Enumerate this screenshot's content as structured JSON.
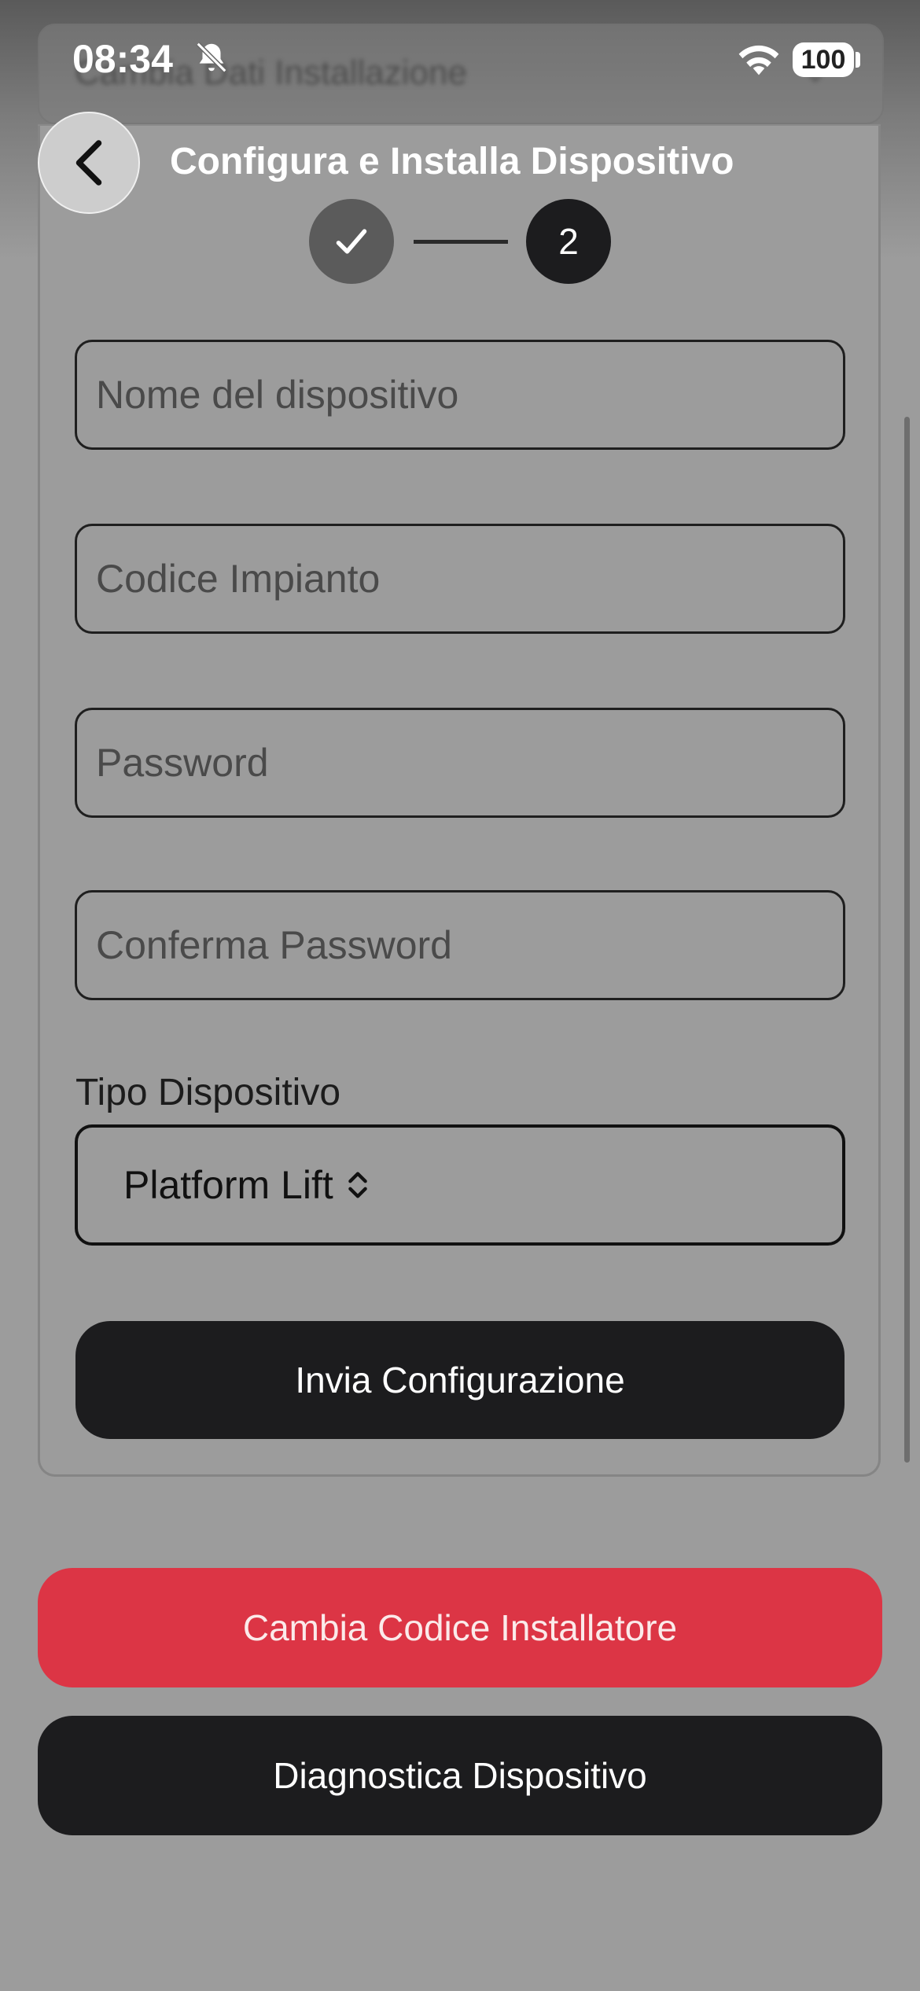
{
  "status_bar": {
    "time": "08:34",
    "battery": "100",
    "icons": [
      "bell-slash-icon",
      "wifi-icon",
      "battery-icon"
    ]
  },
  "background_header": {
    "title": "Cambia Dati Installazione"
  },
  "header": {
    "title": "Configura e Installa Dispositivo",
    "back_icon": "chevron-left-icon"
  },
  "stepper": {
    "step1_icon": "checkmark-icon",
    "step2_label": "2"
  },
  "form": {
    "device_name_placeholder": "Nome del dispositivo",
    "plant_code_placeholder": "Codice Impianto",
    "password_placeholder": "Password",
    "confirm_password_placeholder": "Conferma Password",
    "device_type_label": "Tipo Dispositivo",
    "device_type_value": "Platform Lift",
    "submit_label": "Invia Configurazione"
  },
  "actions": {
    "change_installer_code_label": "Cambia Codice Installatore",
    "diagnostics_label": "Diagnostica Dispositivo"
  },
  "colors": {
    "overlay_gray": "#9c9c9c",
    "primary_dark": "#1c1c1e",
    "danger_red": "#dc3545"
  }
}
